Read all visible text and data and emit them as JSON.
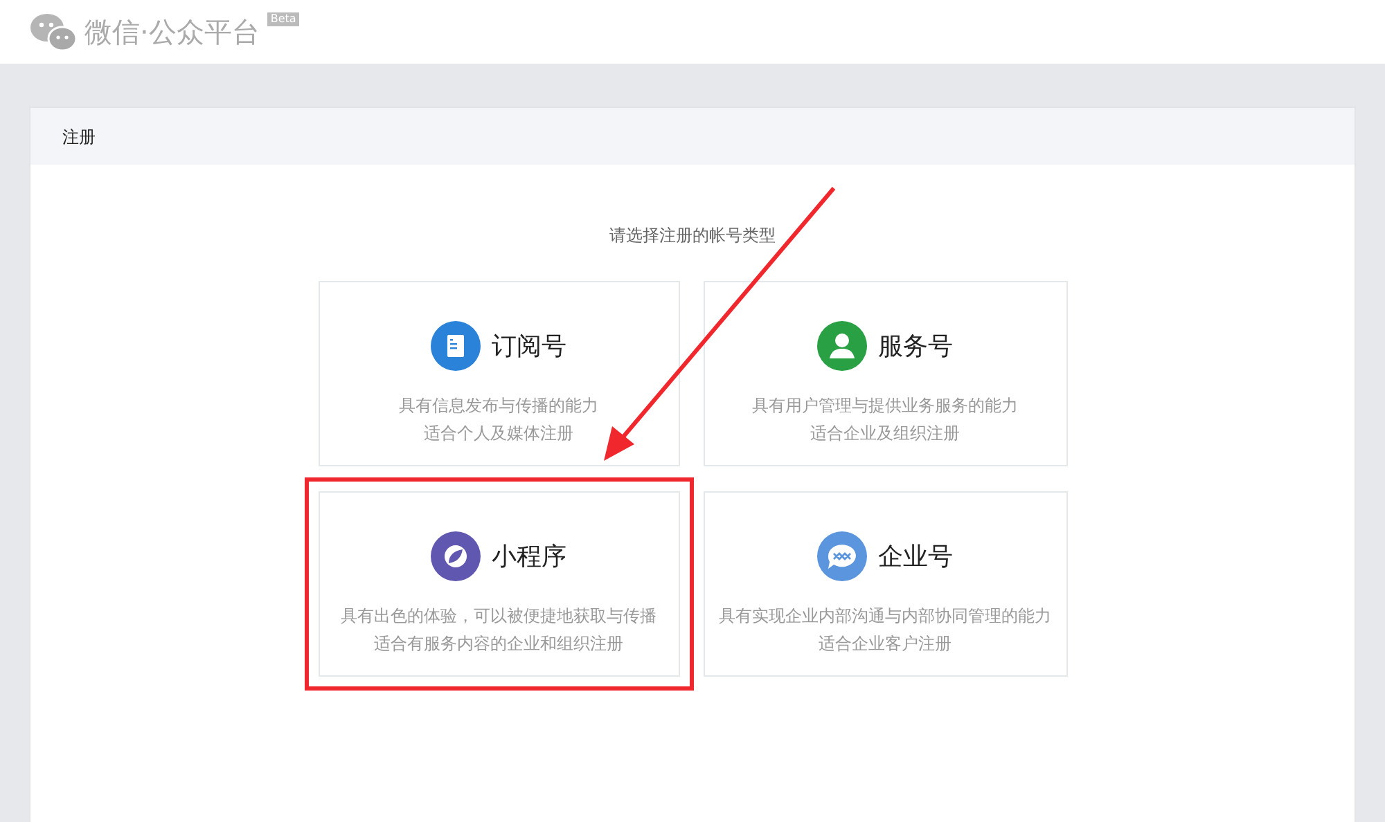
{
  "header": {
    "logo_text": "微信·公众平台",
    "badge": "Beta"
  },
  "panel": {
    "title": "注册",
    "prompt": "请选择注册的帐号类型"
  },
  "account_types": [
    {
      "kind": "subscription",
      "title": "订阅号",
      "lines": [
        "具有信息发布与传播的能力",
        "适合个人及媒体注册"
      ],
      "highlighted": false,
      "color": "#2b82d9"
    },
    {
      "kind": "service",
      "title": "服务号",
      "lines": [
        "具有用户管理与提供业务服务的能力",
        "适合企业及组织注册"
      ],
      "highlighted": false,
      "color": "#2aa044"
    },
    {
      "kind": "miniprogram",
      "title": "小程序",
      "lines": [
        "具有出色的体验，可以被便捷地获取与传播",
        "适合有服务内容的企业和组织注册"
      ],
      "highlighted": true,
      "color": "#6057b0"
    },
    {
      "kind": "enterprise",
      "title": "企业号",
      "lines": [
        "具有实现企业内部沟通与内部协同管理的能力",
        "适合企业客户注册"
      ],
      "highlighted": false,
      "color": "#5a95de"
    }
  ],
  "annotation": {
    "arrow": true
  }
}
